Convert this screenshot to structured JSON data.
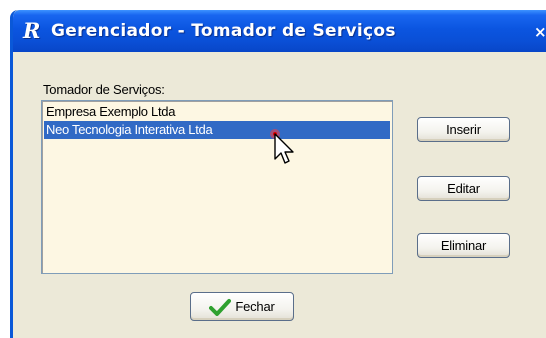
{
  "window": {
    "title": "Gerenciador - Tomador de Serviços",
    "close_label": "×"
  },
  "list": {
    "label": "Tomador de Serviços:",
    "items": [
      {
        "label": "Empresa Exemplo Ltda",
        "selected": false
      },
      {
        "label": "Neo Tecnologia Interativa Ltda",
        "selected": true
      }
    ]
  },
  "buttons": {
    "insert_label": "Inserir",
    "edit_label": "Editar",
    "delete_label": "Eliminar",
    "close_label": "Fechar"
  },
  "icons": {
    "app": "app-logo-icon",
    "close": "close-icon",
    "check": "check-icon",
    "cursor": "mouse-pointer-icon"
  },
  "colors": {
    "titlebar": "#0a4fd6",
    "dialog_bg": "#ece9d8",
    "list_bg": "#fdf7e3",
    "selection": "#316ac5",
    "check_green": "#2fa12f"
  }
}
